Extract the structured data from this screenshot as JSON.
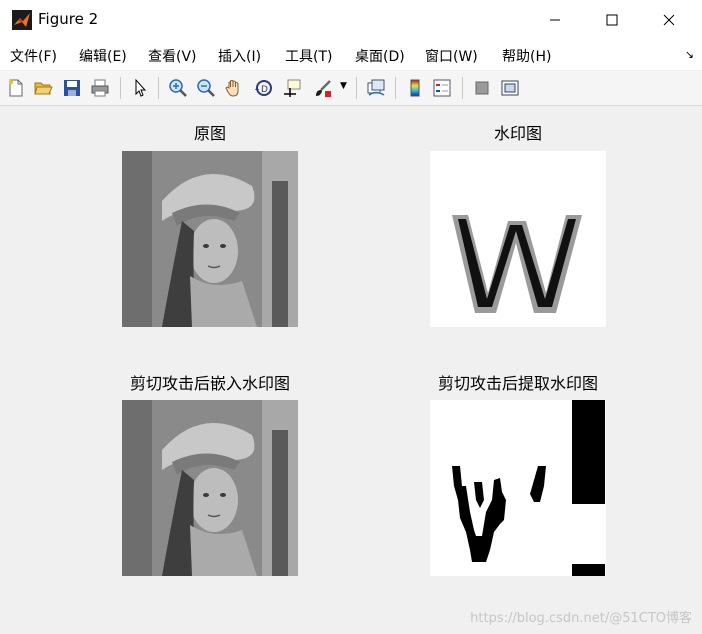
{
  "window": {
    "title": "Figure 2",
    "minimize_icon": "minimize-icon",
    "maximize_icon": "maximize-icon",
    "close_icon": "close-icon"
  },
  "menu": {
    "items": [
      {
        "label": "文件(F)"
      },
      {
        "label": "编辑(E)"
      },
      {
        "label": "查看(V)"
      },
      {
        "label": "插入(I)"
      },
      {
        "label": "工具(T)"
      },
      {
        "label": "桌面(D)"
      },
      {
        "label": "窗口(W)"
      },
      {
        "label": "帮助(H)"
      }
    ],
    "overflow_icon": "dock-arrow-icon"
  },
  "toolbar": {
    "icons": [
      "new-figure-icon",
      "open-file-icon",
      "save-icon",
      "print-icon",
      "pointer-icon",
      "zoom-in-icon",
      "zoom-out-icon",
      "pan-hand-icon",
      "rotate-3d-icon",
      "data-cursor-icon",
      "brush-icon",
      "brush-dropdown-icon",
      "link-plot-icon",
      "colorbar-icon",
      "legend-icon",
      "hide-plot-tools-icon",
      "show-plot-tools-icon"
    ]
  },
  "axes": [
    {
      "title": "原图"
    },
    {
      "title": "水印图"
    },
    {
      "title": "剪切攻击后嵌入水印图"
    },
    {
      "title": "剪切攻击后提取水印图"
    }
  ],
  "overlay": {
    "watermark": "https://blog.csdn.net/@51CTO博客"
  }
}
